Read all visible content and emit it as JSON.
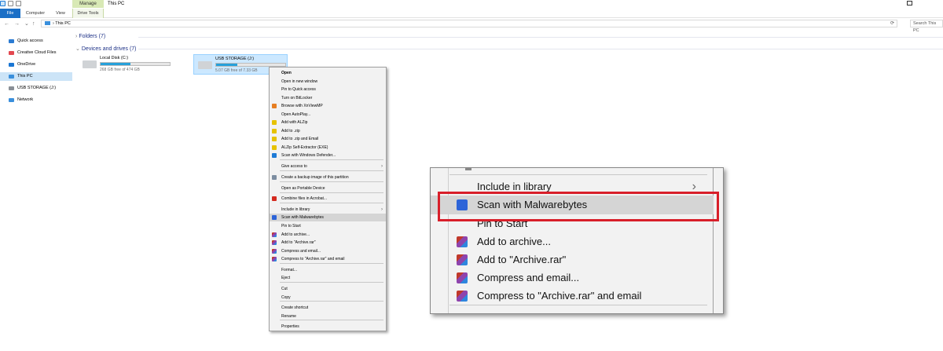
{
  "window": {
    "title": "This PC",
    "manage_tab": "Manage",
    "maximize_glyph": ""
  },
  "ribbon": {
    "tabs": [
      "File",
      "Computer",
      "View"
    ],
    "contextual_tab": "Drive Tools"
  },
  "address": {
    "nav": {
      "back": "←",
      "forward": "→",
      "dropdown": "⌄",
      "up": "↑"
    },
    "separator": "›",
    "path": "This PC",
    "refresh": "⟳",
    "search_placeholder": "Search This PC"
  },
  "sidebar": {
    "items": [
      {
        "label": "Quick access",
        "icon": "star-icon",
        "color": "#2b7bd2"
      },
      {
        "label": "Creative Cloud Files",
        "icon": "creative-cloud-icon",
        "color": "#e34850"
      },
      {
        "label": "OneDrive",
        "icon": "cloud-icon",
        "color": "#1b76d3"
      },
      {
        "label": "This PC",
        "icon": "computer-icon",
        "color": "#3a8fdc",
        "selected": true
      },
      {
        "label": "USB STORAGE (J:)",
        "icon": "usb-drive-icon",
        "color": "#8a8f96"
      },
      {
        "label": "Network",
        "icon": "network-icon",
        "color": "#3a8fdc"
      }
    ]
  },
  "content": {
    "folders_header": "Folders (7)",
    "devices_header": "Devices and drives (7)",
    "chevron_collapsed": "›",
    "chevron_expanded": "⌄",
    "drives": [
      {
        "name": "Local Disk (C:)",
        "free": "268 GB free of 474 GB",
        "used_fraction": 0.43
      },
      {
        "name": "USB STORAGE (J:)",
        "free": "5.07 GB free of 7.33 GB",
        "used_fraction": 0.31
      }
    ]
  },
  "context_menu": {
    "items": [
      {
        "label": "Open",
        "bold": true
      },
      {
        "label": "Open in new window"
      },
      {
        "label": "Pin to Quick access"
      },
      {
        "label": "Turn on BitLocker"
      },
      {
        "label": "Browse with XnViewMP",
        "icon": "xnview-icon"
      },
      {
        "label": "Open AutoPlay..."
      },
      {
        "label": "Add with ALZip",
        "icon": "alzip-icon"
      },
      {
        "label": "Add to .zip",
        "icon": "alzip-icon"
      },
      {
        "label": "Add to .zip and Email",
        "icon": "alzip-icon"
      },
      {
        "label": "ALZip Self-Extractor (EXE)",
        "icon": "alzip-icon"
      },
      {
        "label": "Scan with Windows Defender...",
        "icon": "defender-icon"
      },
      {
        "label": "Give access to",
        "submenu": true
      },
      {
        "label": "Create a backup image of this partition",
        "icon": "backup-icon"
      },
      {
        "label": "Open as Portable Device"
      },
      {
        "label": "Combine files in Acrobat...",
        "icon": "acrobat-icon"
      },
      {
        "label": "Include in library",
        "submenu": true
      },
      {
        "label": "Scan with Malwarebytes",
        "icon": "malwarebytes-icon",
        "highlighted": true
      },
      {
        "label": "Pin to Start"
      },
      {
        "label": "Add to archive...",
        "icon": "winrar-icon"
      },
      {
        "label": "Add to \"Archive.rar\"",
        "icon": "winrar-icon"
      },
      {
        "label": "Compress and email...",
        "icon": "winrar-icon"
      },
      {
        "label": "Compress to \"Archive.rar\" and email",
        "icon": "winrar-icon"
      },
      {
        "label": "Format..."
      },
      {
        "label": "Eject"
      },
      {
        "label": "Cut"
      },
      {
        "label": "Copy"
      },
      {
        "label": "Create shortcut"
      },
      {
        "label": "Rename"
      },
      {
        "label": "Properties"
      }
    ],
    "submenu_arrow": "›"
  },
  "zoom_inset": {
    "items": [
      {
        "label": "Include in library",
        "submenu": true
      },
      {
        "label": "Scan with Malwarebytes",
        "icon": "malwarebytes-icon",
        "highlighted": true
      },
      {
        "label": "Pin to Start"
      },
      {
        "label": "Add to archive...",
        "icon": "winrar-icon"
      },
      {
        "label": "Add to \"Archive.rar\"",
        "icon": "winrar-icon"
      },
      {
        "label": "Compress and email...",
        "icon": "winrar-icon"
      },
      {
        "label": "Compress to \"Archive.rar\" and email",
        "icon": "winrar-icon"
      }
    ],
    "highlight_color": "#d81f2a"
  }
}
